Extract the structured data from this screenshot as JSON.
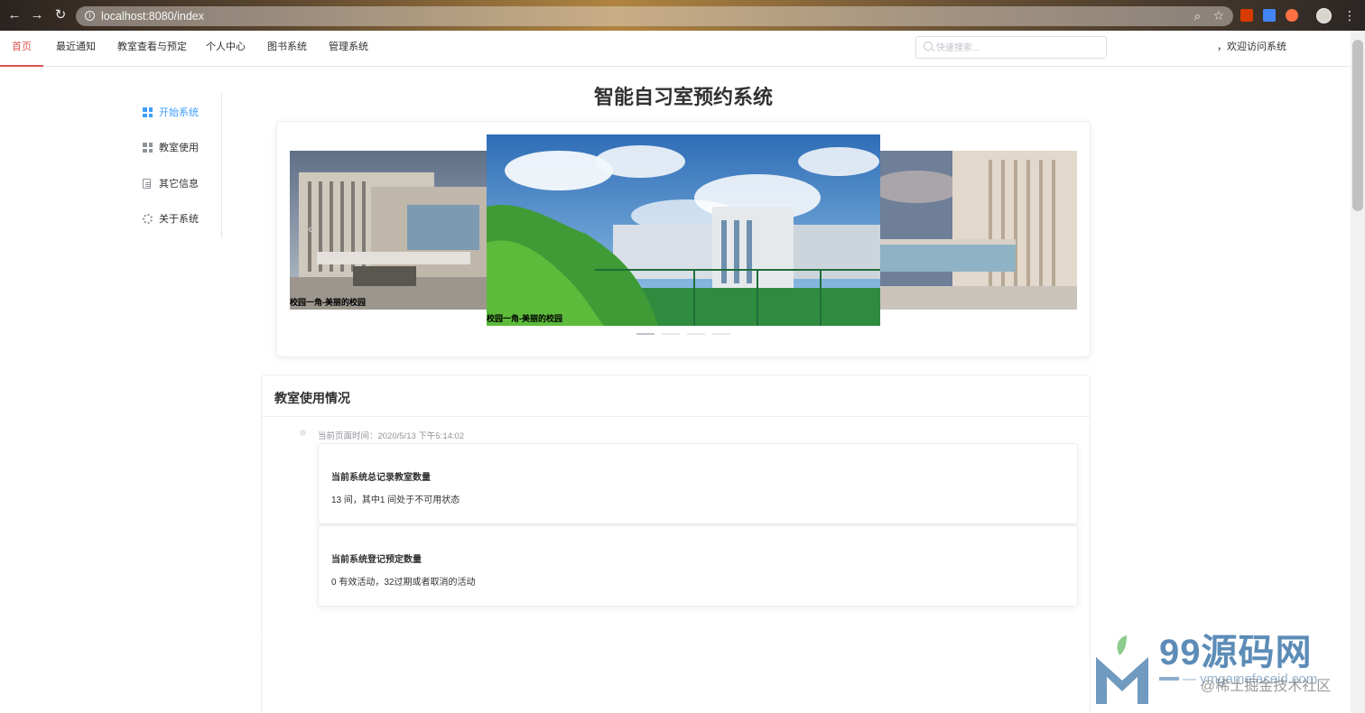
{
  "browser": {
    "url": "localhost:8080/index"
  },
  "topnav": {
    "items": [
      {
        "label": "首页",
        "active": true
      },
      {
        "label": "最近通知"
      },
      {
        "label": "教室查看与预定"
      },
      {
        "label": "个人中心"
      },
      {
        "label": "图书系统"
      },
      {
        "label": "管理系统"
      }
    ],
    "search_placeholder": "快速搜索...",
    "welcome": "，欢迎访问系统"
  },
  "sidebar": {
    "items": [
      {
        "label": "开始系统",
        "icon": "grid-icon",
        "active": true
      },
      {
        "label": "教室使用",
        "icon": "grid-icon"
      },
      {
        "label": "其它信息",
        "icon": "document-icon"
      },
      {
        "label": "关于系统",
        "icon": "gear-icon"
      }
    ]
  },
  "main": {
    "title": "智能自习室预约系统",
    "carousel": {
      "captions": {
        "left": "校园一角-美丽的校园",
        "center": "校园一角-美丽的校园"
      },
      "active_index": 0,
      "count": 4
    },
    "usage": {
      "title": "教室使用情况",
      "timeline_time": "当前页面时间：2020/5/13 下午5:14:02",
      "stats": [
        {
          "heading": "当前系统总记录教室数量",
          "value": "13 间，其中1 间处于不可用状态"
        },
        {
          "heading": "当前系统登记预定数量",
          "value": "0 有效活动，32过期或者取消的活动"
        }
      ]
    }
  },
  "watermark": {
    "name": "99源码网",
    "url": "— ymgamefaceid.com",
    "credit": "@稀土掘金技术社区"
  },
  "colors": {
    "nav_active": "#d9534f",
    "sidebar_active": "#409eff"
  }
}
